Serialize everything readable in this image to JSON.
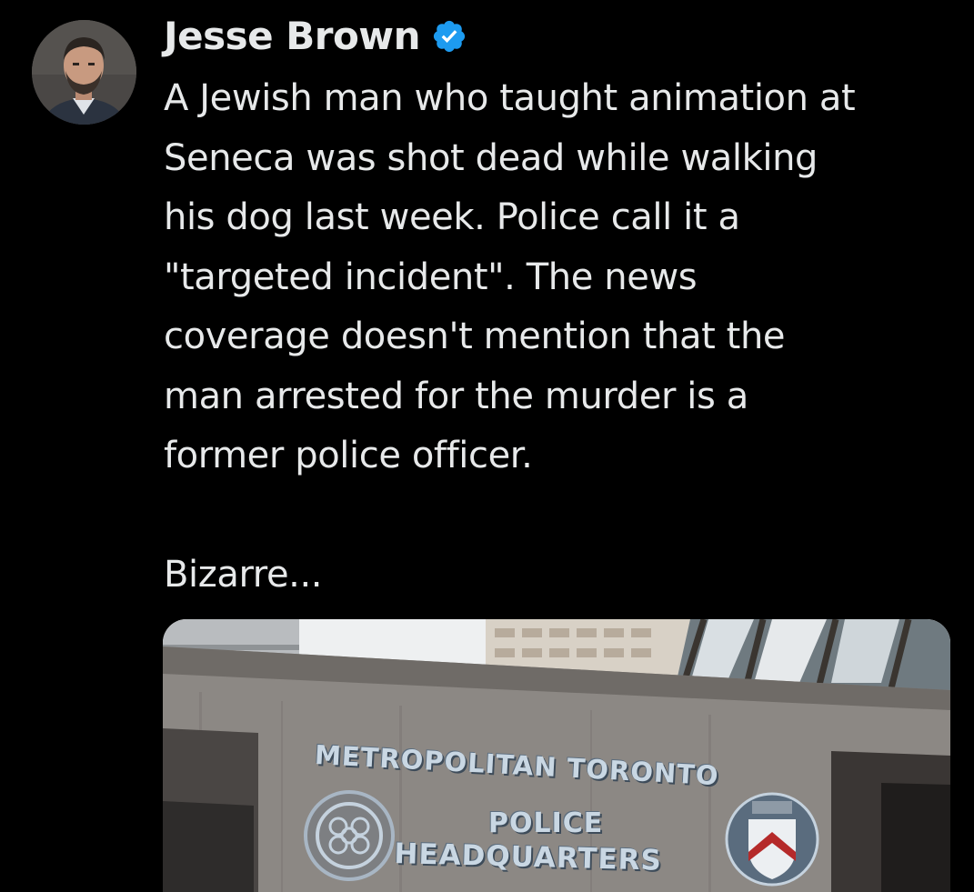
{
  "author": {
    "display_name": "Jesse Brown",
    "verified": true,
    "avatar_icon": "avatar-photo"
  },
  "tweet": {
    "lines": [
      "A Jewish man who taught animation at",
      "Seneca was shot dead while walking",
      "his dog last week. Police call it a",
      "\"targeted incident\". The news",
      "coverage doesn't mention that the",
      "man arrested for the murder is a",
      "former police officer."
    ],
    "closing": "Bizarre..."
  },
  "media": {
    "sign_line_1": "METROPOLITAN TORONTO",
    "sign_line_2": "POLICE",
    "sign_line_3": "HEADQUARTERS"
  },
  "colors": {
    "background": "#000000",
    "text": "#e7e9ea",
    "verified_badge": "#1d9bf0"
  }
}
